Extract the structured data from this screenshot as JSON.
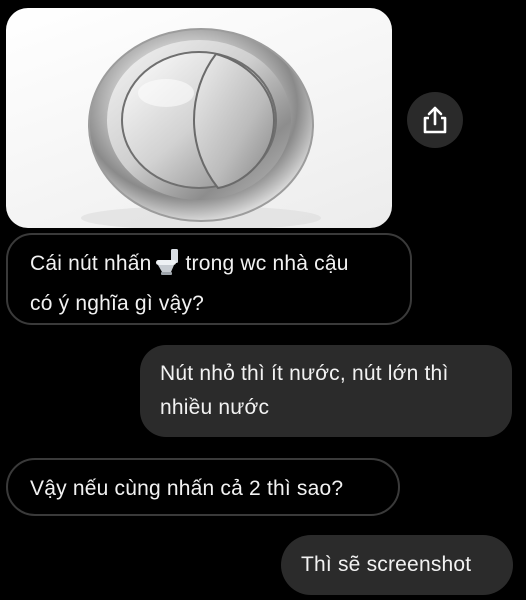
{
  "messages": [
    {
      "direction": "incoming",
      "text_before_emoji": "Cái nút nhấn",
      "emoji": "toilet-emoji",
      "text_after_emoji": "trong wc nhà cậu",
      "line2": "có ý nghĩa gì vậy?"
    },
    {
      "direction": "outgoing",
      "line1": "Nút nhỏ thì ít nước, nút lớn thì",
      "line2": "nhiều nước"
    },
    {
      "direction": "incoming",
      "text": "Vậy nếu cùng nhấn cả 2 thì sao?"
    },
    {
      "direction": "outgoing",
      "text": "Thì sẽ screenshot"
    }
  ],
  "photo": {
    "subject": "dual-flush-toilet-button"
  },
  "share_button": {
    "icon": "share-icon"
  },
  "colors": {
    "background": "#000000",
    "outgoing_bubble": "#2b2b2b",
    "incoming_border": "#3a3a3a",
    "text": "#f2f2f2"
  }
}
